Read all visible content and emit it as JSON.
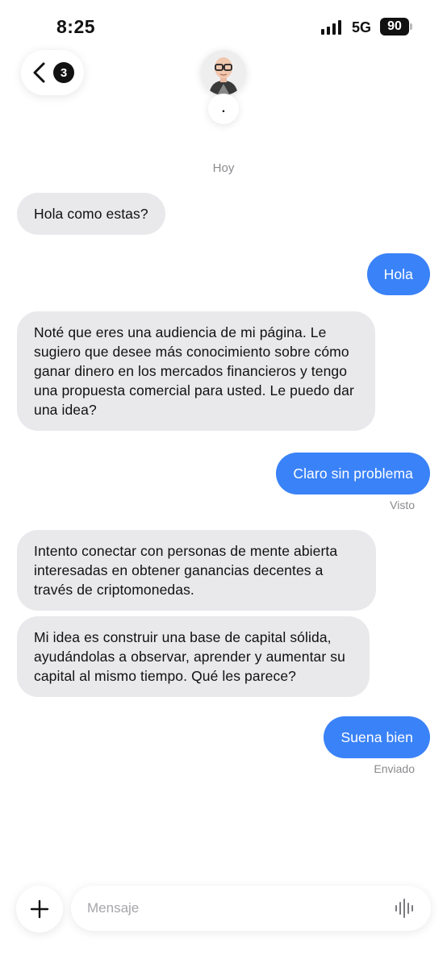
{
  "status_bar": {
    "time": "8:25",
    "network": "5G",
    "battery": "90"
  },
  "header": {
    "unread_count": "3",
    "contact_name": "."
  },
  "thread": {
    "day_label": "Hoy",
    "messages": [
      {
        "direction": "incoming",
        "text": "Hola como estas?"
      },
      {
        "direction": "outgoing",
        "text": "Hola"
      },
      {
        "direction": "incoming",
        "text": "Noté que eres una audiencia de mi página. Le sugiero que desee más conocimiento sobre cómo ganar dinero en los mercados financieros y tengo una propuesta comercial para usted. Le puedo dar una idea?"
      },
      {
        "direction": "outgoing",
        "text": "Claro sin problema",
        "receipt": "Visto"
      },
      {
        "direction": "incoming",
        "text": "Intento conectar con personas de mente abierta interesadas en obtener ganancias decentes a través de criptomonedas."
      },
      {
        "direction": "incoming",
        "text": "Mi idea es construir una base de capital sólida, ayudándolas a observar, aprender y aumentar su capital al mismo tiempo. Qué les parece?"
      },
      {
        "direction": "outgoing",
        "text": "Suena bien",
        "receipt": "Enviado"
      }
    ]
  },
  "composer": {
    "placeholder": "Mensaje",
    "value": ""
  },
  "colors": {
    "outgoing_bubble": "#3a82f7",
    "incoming_bubble": "#e9e9eb",
    "meta_text": "#8a8a8e"
  }
}
